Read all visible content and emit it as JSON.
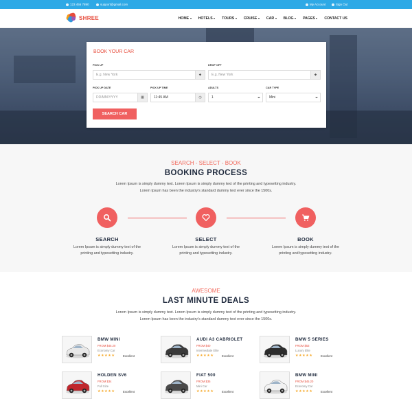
{
  "topbar": {
    "phone": "123 456 7890",
    "email": "support@gmail.com",
    "my_account": "My Account",
    "sign_out": "Sign Out"
  },
  "brand": {
    "name": "SHREE"
  },
  "nav": {
    "items": [
      {
        "label": "HOME",
        "has_dropdown": true
      },
      {
        "label": "HOTELS",
        "has_dropdown": true
      },
      {
        "label": "TOURS",
        "has_dropdown": true
      },
      {
        "label": "CRUISE",
        "has_dropdown": true
      },
      {
        "label": "CAR",
        "has_dropdown": true
      },
      {
        "label": "BLOG",
        "has_dropdown": true
      },
      {
        "label": "PAGES",
        "has_dropdown": true
      },
      {
        "label": "CONTACT US",
        "has_dropdown": false
      }
    ]
  },
  "booking_form": {
    "title": "BOOK YOUR CAR",
    "pickup_label": "PICK UP",
    "pickup_placeholder": "E.g. New York",
    "dropoff_label": "DROP OFF",
    "dropoff_placeholder": "E.g. New York",
    "pickup_date_label": "PICK UP DATE",
    "pickup_date_placeholder": "DD/MM/YYYY",
    "pickup_time_label": "PICK UP TIME",
    "pickup_time_value": "11:45 AM",
    "adults_label": "ADULTS",
    "adults_value": "1",
    "car_type_label": "CAR TYPE",
    "car_type_value": "Mini",
    "search_button": "SEARCH CAR"
  },
  "process": {
    "subtitle": "SEARCH - SELECT - BOOK",
    "title": "BOOKING PROCESS",
    "desc_line1": "Lorem Ipsum is simply dummy text. Lorem Ipsum is simply dummy text of the printing and typesetting industry.",
    "desc_line2": "Lorem Ipsum has been the industry's standard dummy text ever since the 1500s.",
    "steps": [
      {
        "title": "SEARCH",
        "icon": "search-icon",
        "desc1": "Lorem Ipsum is simply dummy text of the",
        "desc2": "printing and typesetting industry."
      },
      {
        "title": "SELECT",
        "icon": "heart-icon",
        "desc1": "Lorem Ipsum is simply dummy text of the",
        "desc2": "printing and typesetting industry."
      },
      {
        "title": "BOOK",
        "icon": "cart-icon",
        "desc1": "Lorem Ipsum is simply dummy text of the",
        "desc2": "printing and typesetting industry."
      }
    ]
  },
  "deals": {
    "subtitle": "AWESOME",
    "title": "LAST MINUTE DEALS",
    "desc_line1": "Lorem Ipsum is simply dummy text. Lorem Ipsum is simply dummy text of the printing and typesetting industry.",
    "desc_line2": "Lorem Ipsum has been the industry's standard dummy text ever since the 1500s.",
    "items": [
      {
        "name": "BMW MINI",
        "price": "FROM $45.20",
        "category": "Economy Car",
        "rating": "Excellent",
        "car_color": "#e8e8e8"
      },
      {
        "name": "AUDI A3 CABRIOLET",
        "price": "FROM $40",
        "category": "Intermediate Elite",
        "rating": "Excellent",
        "car_color": "#3a3a3a"
      },
      {
        "name": "BMW 5 SERIES",
        "price": "FROM $53",
        "category": "Luxury Elite",
        "rating": "Excellent",
        "car_color": "#2c2c2c"
      },
      {
        "name": "HOLDEN SV6",
        "price": "FROM $34",
        "category": "Full Size",
        "rating": "Excellent",
        "car_color": "#c0262c"
      },
      {
        "name": "FIAT 500",
        "price": "FROM $35",
        "category": "Mini Car",
        "rating": "Excellent",
        "car_color": "#4a4a4a"
      },
      {
        "name": "BMW MINI",
        "price": "FROM $45.20",
        "category": "Economy Car",
        "rating": "Excellent",
        "car_color": "#f2f2f2"
      }
    ],
    "stars": "★★★★★"
  },
  "colors": {
    "topbar": "#2ea9e6",
    "accent": "#f06060",
    "heading": "#1f2a3d",
    "star": "#f5a623"
  }
}
